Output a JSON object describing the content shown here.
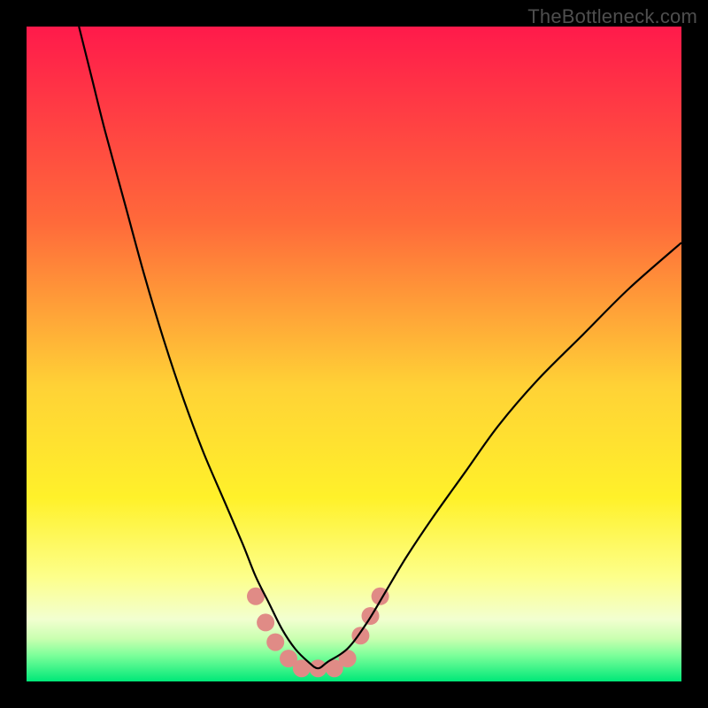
{
  "watermark": {
    "text": "TheBottleneck.com"
  },
  "chart_data": {
    "type": "line",
    "title": "",
    "xlabel": "",
    "ylabel": "",
    "xlim": [
      0,
      100
    ],
    "ylim": [
      0,
      100
    ],
    "grid": false,
    "legend": false,
    "background_gradient": {
      "stops": [
        {
          "offset": 0.0,
          "color": "#ff1a4b"
        },
        {
          "offset": 0.3,
          "color": "#ff6a3a"
        },
        {
          "offset": 0.55,
          "color": "#ffd236"
        },
        {
          "offset": 0.72,
          "color": "#fff12a"
        },
        {
          "offset": 0.84,
          "color": "#fdff8a"
        },
        {
          "offset": 0.905,
          "color": "#f2ffd0"
        },
        {
          "offset": 0.935,
          "color": "#c9ffb0"
        },
        {
          "offset": 0.96,
          "color": "#7dff9a"
        },
        {
          "offset": 1.0,
          "color": "#00e878"
        }
      ]
    },
    "series": [
      {
        "name": "bottleneck-curve",
        "color": "#000000",
        "x": [
          8,
          10,
          12,
          15,
          18,
          21,
          24,
          27,
          30,
          33,
          35,
          37,
          39,
          41,
          43,
          44.5,
          46,
          49,
          52,
          55,
          58,
          62,
          67,
          72,
          78,
          85,
          92,
          100
        ],
        "y": [
          100,
          92,
          84,
          73,
          62,
          52,
          43,
          35,
          28,
          21,
          16,
          12,
          8,
          5,
          3,
          2,
          3,
          5,
          9,
          14,
          19,
          25,
          32,
          39,
          46,
          53,
          60,
          67
        ]
      }
    ],
    "markers": {
      "name": "highlight-dots",
      "color": "#e08b86",
      "radius_px": 10,
      "points": [
        {
          "x": 35.0,
          "y": 13.0
        },
        {
          "x": 36.5,
          "y": 9.0
        },
        {
          "x": 38.0,
          "y": 6.0
        },
        {
          "x": 40.0,
          "y": 3.5
        },
        {
          "x": 42.0,
          "y": 2.0
        },
        {
          "x": 44.5,
          "y": 2.0
        },
        {
          "x": 47.0,
          "y": 2.0
        },
        {
          "x": 49.0,
          "y": 3.5
        },
        {
          "x": 51.0,
          "y": 7.0
        },
        {
          "x": 52.5,
          "y": 10.0
        },
        {
          "x": 54.0,
          "y": 13.0
        }
      ]
    }
  }
}
